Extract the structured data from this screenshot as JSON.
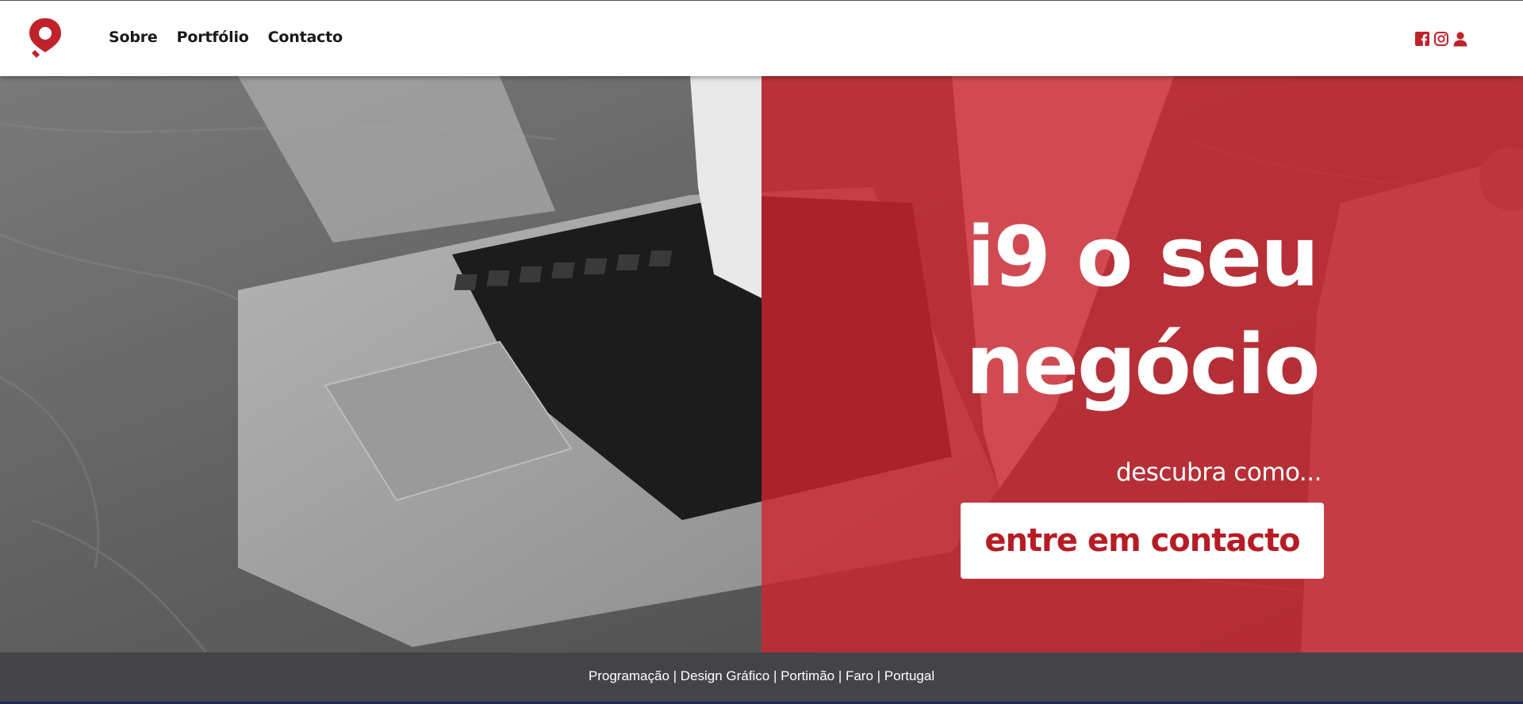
{
  "header": {
    "logo_label": "Logo",
    "nav": {
      "about": "Sobre",
      "portfolio": "Portfólio",
      "contact": "Contacto"
    },
    "social_icons": [
      "facebook-icon",
      "instagram-icon",
      "user-icon"
    ]
  },
  "hero": {
    "headline_line1": "i9 o seu",
    "headline_line2": "negócio",
    "subtitle": "descubra como...",
    "cta_label": "entre em contacto"
  },
  "footer": {
    "text": "Programação | Design Gráfico | Portimão | Faro | Portugal"
  },
  "colors": {
    "brand_red": "#c0222c",
    "overlay_red": "#ce2630",
    "footer_bg": "#444448",
    "header_bg": "#ffffff"
  }
}
